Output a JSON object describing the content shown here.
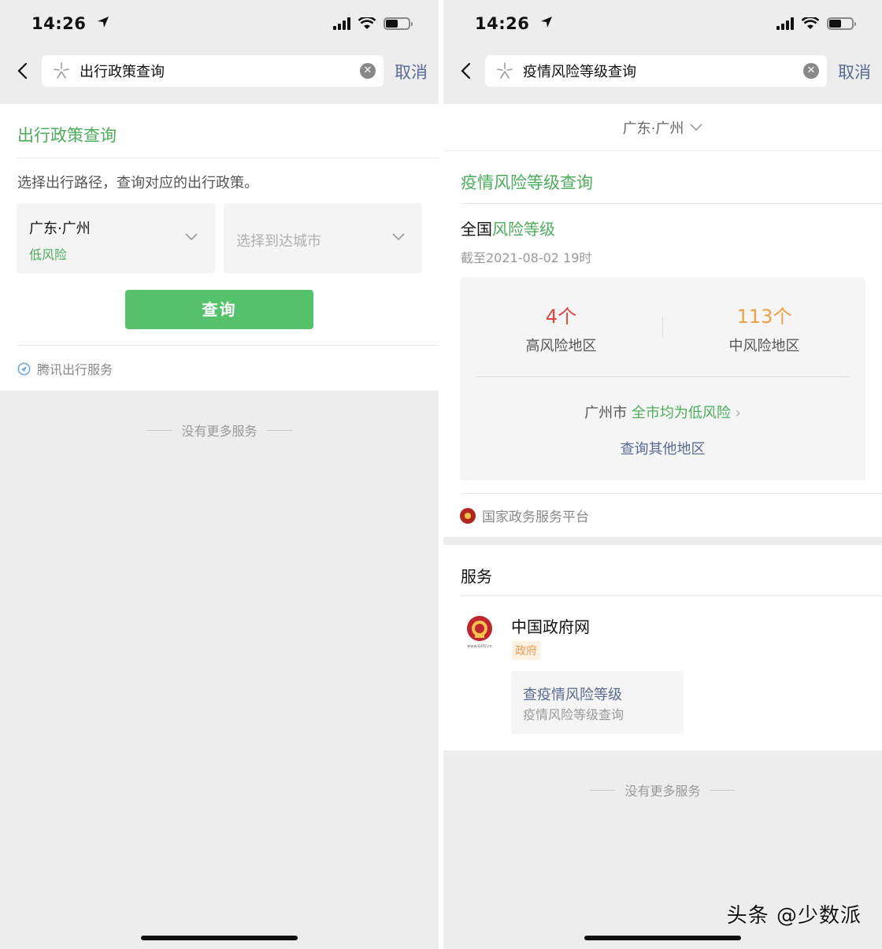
{
  "status": {
    "time": "14:26"
  },
  "left": {
    "search_query": "出行政策查询",
    "cancel_label": "取消",
    "card_title": "出行政策查询",
    "description": "选择出行路径，查询对应的出行政策。",
    "origin": {
      "city": "广东·广州",
      "risk": "低风险"
    },
    "destination_placeholder": "选择到达城市",
    "query_button": "查询",
    "provider": "腾讯出行服务",
    "no_more": "没有更多服务"
  },
  "right": {
    "search_query": "疫情风险等级查询",
    "cancel_label": "取消",
    "region": "广东·广州",
    "card_title": "疫情风险等级查询",
    "national_prefix": "全国",
    "national_suffix": "风险等级",
    "as_of": "截至2021-08-02 19时",
    "high_risk": {
      "count": "4个",
      "label": "高风险地区"
    },
    "mid_risk": {
      "count": "113个",
      "label": "中风险地区"
    },
    "city_name": "广州市",
    "city_status": "全市均为低风险",
    "other_regions": "查询其他地区",
    "provider": "国家政务服务平台",
    "services_title": "服务",
    "service": {
      "name": "中国政府网",
      "tag": "政府",
      "logo_caption": "www.GOV.cn",
      "link_title": "查疫情风险等级",
      "link_desc": "疫情风险等级查询"
    },
    "no_more": "没有更多服务"
  },
  "watermark": "头条 @少数派"
}
